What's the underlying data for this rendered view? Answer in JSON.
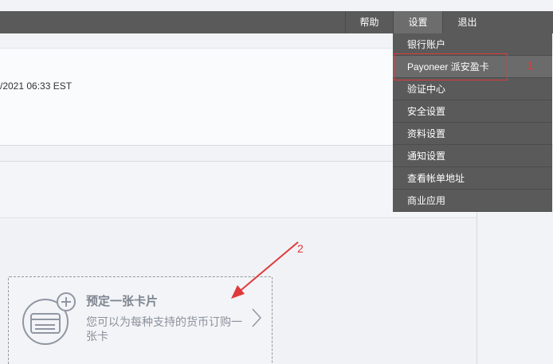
{
  "topnav": {
    "help_label": "帮助",
    "settings_label": "设置",
    "logout_label": "退出"
  },
  "main": {
    "timestamp": "/2021 06:33 EST"
  },
  "card": {
    "title": "预定一张卡片",
    "description": "您可以为每种支持的货币订购一张卡"
  },
  "dropdown": {
    "items": [
      {
        "label": "银行账户"
      },
      {
        "label": "Payoneer 派安盈卡"
      },
      {
        "label": "验证中心"
      },
      {
        "label": "安全设置"
      },
      {
        "label": "资料设置"
      },
      {
        "label": "通知设置"
      },
      {
        "label": "查看帐单地址"
      },
      {
        "label": "商业应用"
      }
    ]
  },
  "annotations": {
    "step1": "1",
    "step2": "2"
  },
  "colors": {
    "topbar": "#5a5a5a",
    "annotation_red": "#e0393b",
    "card_text": "#8a919c"
  }
}
